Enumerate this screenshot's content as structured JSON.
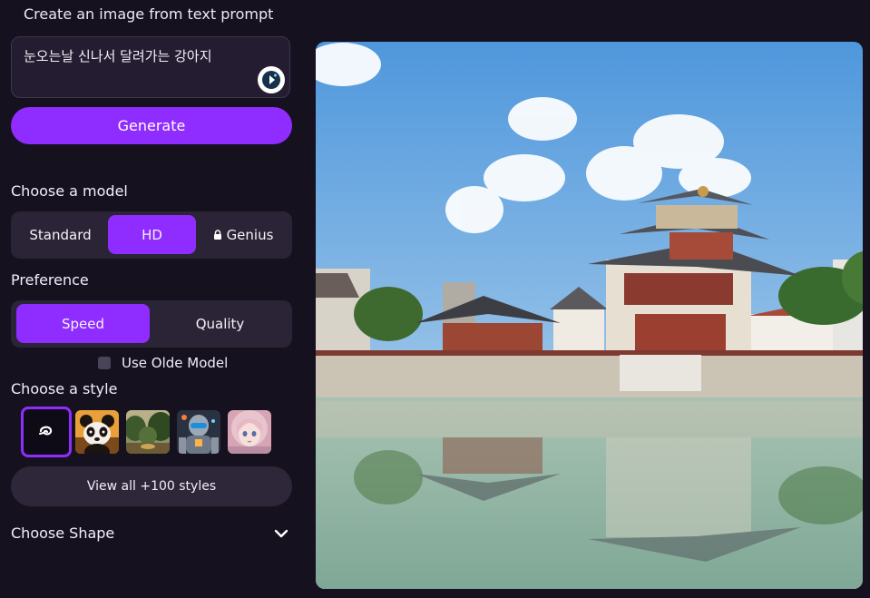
{
  "panel": {
    "title": "Create an image from text prompt",
    "prompt_value": "눈오는날 신나서 달려가는 강아지",
    "generate_label": "Generate",
    "model": {
      "heading": "Choose a model",
      "options": [
        "Standard",
        "HD",
        "Genius"
      ],
      "selected": "HD",
      "locked": [
        "Genius"
      ]
    },
    "preference": {
      "heading": "Preference",
      "options": [
        "Speed",
        "Quality"
      ],
      "selected": "Speed"
    },
    "olde_model_label": "Use Olde Model",
    "olde_model_checked": false,
    "style": {
      "heading": "Choose a style",
      "thumbnails": [
        "no-style-swirl",
        "panda",
        "forest",
        "robot",
        "anime-girl"
      ],
      "selected": "no-style-swirl"
    },
    "view_all_label": "View all +100 styles",
    "shape_label": "Choose Shape"
  },
  "colors": {
    "accent": "#8f2cff",
    "background": "#16111f",
    "segment_bg": "#2a2436"
  },
  "result": {
    "subject": "traditional asian pavilion reflected in pond"
  }
}
